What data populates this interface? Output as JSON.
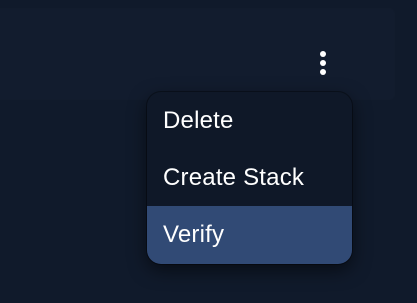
{
  "card": {
    "more_options_icon": "kebab-vertical-icon"
  },
  "menu": {
    "items": [
      {
        "label": "Delete",
        "active": false
      },
      {
        "label": "Create Stack",
        "active": false
      },
      {
        "label": "Verify",
        "active": true
      }
    ]
  },
  "colors": {
    "background": "#101a2b",
    "card": "#121c2e",
    "menu_background": "#0f1828",
    "active_item": "#314a75",
    "text": "#ffffff"
  }
}
